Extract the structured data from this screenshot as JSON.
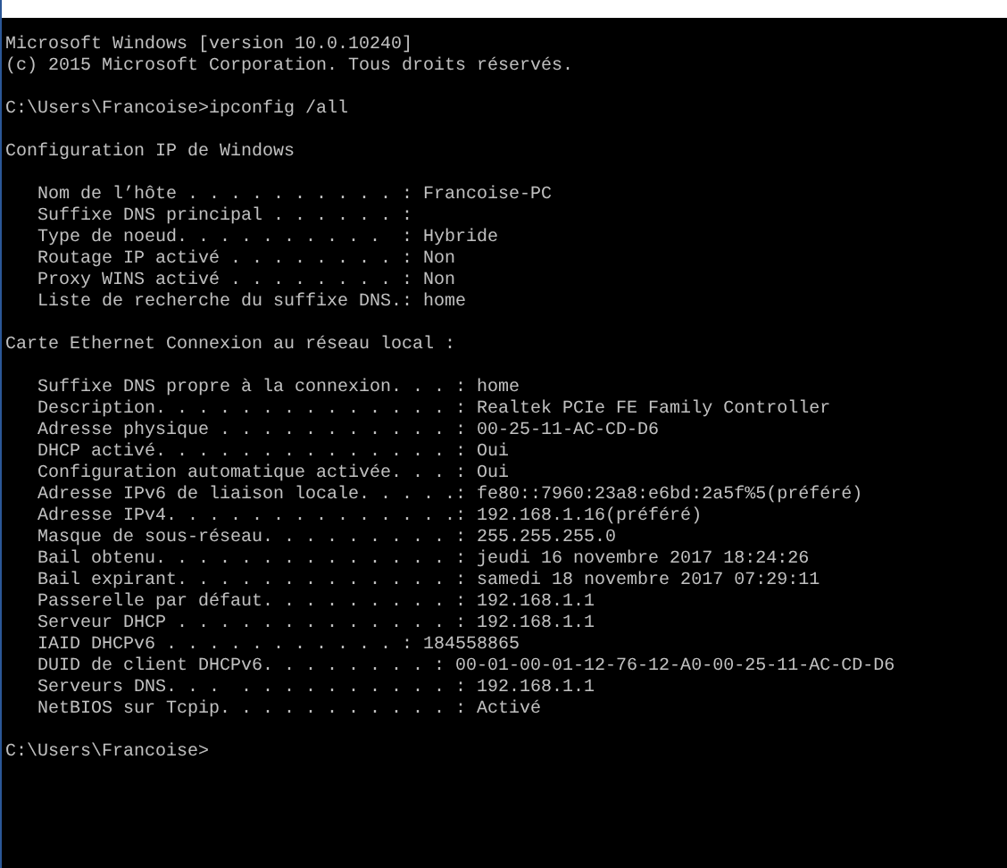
{
  "console": {
    "lines": [
      {
        "kind": "text",
        "text": "Microsoft Windows [version 10.0.10240]"
      },
      {
        "kind": "text",
        "text": "(c) 2015 Microsoft Corporation. Tous droits réservés."
      },
      {
        "kind": "blank"
      },
      {
        "kind": "text",
        "text": "C:\\Users\\Francoise>ipconfig /all"
      },
      {
        "kind": "blank"
      },
      {
        "kind": "text",
        "text": "Configuration IP de Windows"
      },
      {
        "kind": "blank"
      },
      {
        "kind": "text",
        "text": "   Nom de l’hôte . . . . . . . . . . : Francoise-PC"
      },
      {
        "kind": "text",
        "text": "   Suffixe DNS principal . . . . . . :"
      },
      {
        "kind": "text",
        "text": "   Type de noeud. . . . . . . . . .  : Hybride"
      },
      {
        "kind": "text",
        "text": "   Routage IP activé . . . . . . . . : Non"
      },
      {
        "kind": "text",
        "text": "   Proxy WINS activé . . . . . . . . : Non"
      },
      {
        "kind": "text",
        "text": "   Liste de recherche du suffixe DNS.: home"
      },
      {
        "kind": "blank"
      },
      {
        "kind": "text",
        "text": "Carte Ethernet Connexion au réseau local :"
      },
      {
        "kind": "blank"
      },
      {
        "kind": "text",
        "text": "   Suffixe DNS propre à la connexion. . . : home"
      },
      {
        "kind": "text",
        "text": "   Description. . . . . . . . . . . . . . : Realtek PCIe FE Family Controller"
      },
      {
        "kind": "text",
        "text": "   Adresse physique . . . . . . . . . . . : 00-25-11-AC-CD-D6"
      },
      {
        "kind": "text",
        "text": "   DHCP activé. . . . . . . . . . . . . . : Oui"
      },
      {
        "kind": "text",
        "text": "   Configuration automatique activée. . . : Oui"
      },
      {
        "kind": "text",
        "text": "   Adresse IPv6 de liaison locale. . . . .: fe80::7960:23a8:e6bd:2a5f%5(préféré)"
      },
      {
        "kind": "text",
        "text": "   Adresse IPv4. . . . . . . . . . . . . .: 192.168.1.16(préféré)"
      },
      {
        "kind": "text",
        "text": "   Masque de sous-réseau. . . . . . . . . : 255.255.255.0"
      },
      {
        "kind": "text",
        "text": "   Bail obtenu. . . . . . . . . . . . . . : jeudi 16 novembre 2017 18:24:26"
      },
      {
        "kind": "text",
        "text": "   Bail expirant. . . . . . . . . . . . . : samedi 18 novembre 2017 07:29:11"
      },
      {
        "kind": "text",
        "text": "   Passerelle par défaut. . . . . . . . . : 192.168.1.1"
      },
      {
        "kind": "text",
        "text": "   Serveur DHCP . . . . . . . . . . . . . : 192.168.1.1"
      },
      {
        "kind": "text",
        "text": "   IAID DHCPv6 . . . . . . . . . . . : 184558865"
      },
      {
        "kind": "text",
        "text": "   DUID de client DHCPv6. . . . . . . . : 00-01-00-01-12-76-12-A0-00-25-11-AC-CD-D6"
      },
      {
        "kind": "text",
        "text": "   Serveurs DNS. . .  . . . . . . . . . . : 192.168.1.1"
      },
      {
        "kind": "text",
        "text": "   NetBIOS sur Tcpip. . . . . . . . . . . : Activé"
      },
      {
        "kind": "blank"
      },
      {
        "kind": "text",
        "text": "C:\\Users\\Francoise>"
      }
    ]
  }
}
